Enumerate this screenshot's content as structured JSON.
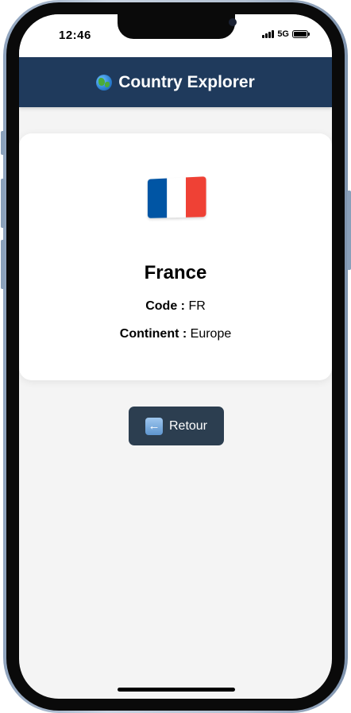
{
  "status_bar": {
    "time": "12:46",
    "network": "5G",
    "signal_icon": "cellular-signal-icon",
    "battery_icon": "battery-icon"
  },
  "header": {
    "icon": "globe-icon",
    "title": "Country Explorer",
    "color": "#1f3a5c"
  },
  "country": {
    "flag_icon": "france-flag-icon",
    "flag_colors": [
      "#0055a4",
      "#ffffff",
      "#ef4135"
    ],
    "name": "France",
    "code_label": "Code :",
    "code_value": "FR",
    "continent_label": "Continent :",
    "continent_value": "Europe"
  },
  "back_button": {
    "icon": "back-arrow-icon",
    "label": "Retour",
    "color": "#2c3e50"
  }
}
